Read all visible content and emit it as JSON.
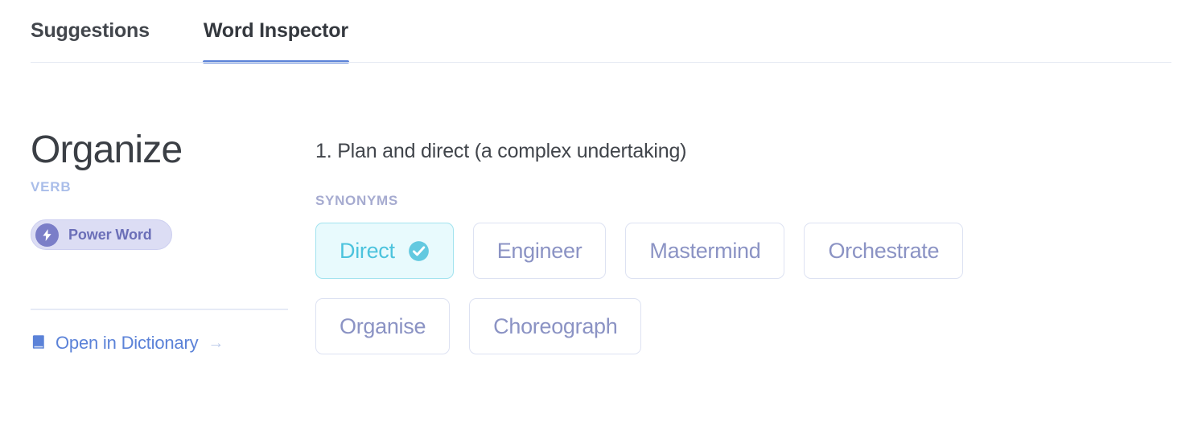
{
  "tabs": [
    {
      "label": "Suggestions",
      "active": false
    },
    {
      "label": "Word Inspector",
      "active": true
    }
  ],
  "word_panel": {
    "title": "Organize",
    "part_of_speech": "VERB",
    "badge": {
      "label": "Power Word",
      "icon": "lightning-bolt-icon",
      "bg_color": "#dcddf4",
      "icon_bg_color": "#7b7ec8",
      "text_color": "#6b6fb8"
    },
    "dictionary_link": {
      "icon": "book-icon",
      "label": "Open in Dictionary",
      "arrow": "→",
      "color": "#5b82d8"
    }
  },
  "definition_panel": {
    "definition": "1. Plan and direct (a complex undertaking)",
    "synonyms_label": "SYNONYMS",
    "synonym_rows": [
      [
        {
          "label": "Direct",
          "selected": true,
          "icon": "check-circle-icon"
        },
        {
          "label": "Engineer",
          "selected": false
        },
        {
          "label": "Mastermind",
          "selected": false
        },
        {
          "label": "Orchestrate",
          "selected": false
        }
      ],
      [
        {
          "label": "Organise",
          "selected": false
        },
        {
          "label": "Choreograph",
          "selected": false
        }
      ]
    ]
  },
  "colors": {
    "accent_blue": "#5b82d8",
    "selected_cyan": "#4cc3dd",
    "selected_cyan_bg": "#e8fafd",
    "chip_border": "#dde2f2",
    "chip_text": "#8b93c4",
    "pos_text": "#a9bde9"
  }
}
